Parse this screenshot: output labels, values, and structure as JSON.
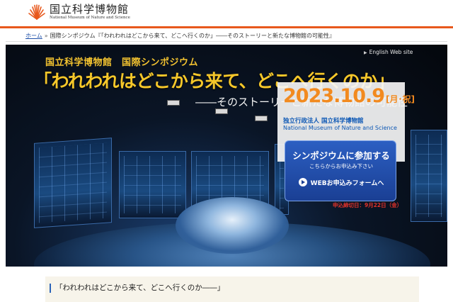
{
  "header": {
    "logo_jp": "国立科学博物館",
    "logo_en": "National Museum of Nature and Science"
  },
  "breadcrumb": {
    "home": "ホーム",
    "separator": "»",
    "items": [
      "国際シンポジウム『「われわれはどこから来て、どこへ行くのか」――そのストーリーと新たな博物館の可能性』"
    ]
  },
  "hero": {
    "english_link": "English Web site",
    "subtitle_top": "国立科学博物館　国際シンポジウム",
    "title": "「われわれはどこから来て、どこへ行くのか」",
    "subtitle": "――そのストーリーと新たな博物館の可能性"
  },
  "event": {
    "date_main": "2023.10.9",
    "date_day": "[月･祝]",
    "org_jp": "独立行政法人 国立科学博物館",
    "org_en": "National Museum of Nature and Science",
    "join_title": "シンポジウムに参加する",
    "join_note": "こちらからお申込み下さい",
    "apply_label": "WEBお申込みフォームへ",
    "deadline": "申込締切日：9月22日（金）"
  },
  "content": {
    "section_heading": "「われわれはどこから来て、どこへ行くのか――」"
  },
  "colors": {
    "accent_orange": "#e8581c",
    "title_gold": "#f5c72a",
    "date_orange": "#f28a1f",
    "org_blue": "#0d58b5",
    "button_blue": "#1a3f94",
    "deadline_red": "#e0322a"
  }
}
